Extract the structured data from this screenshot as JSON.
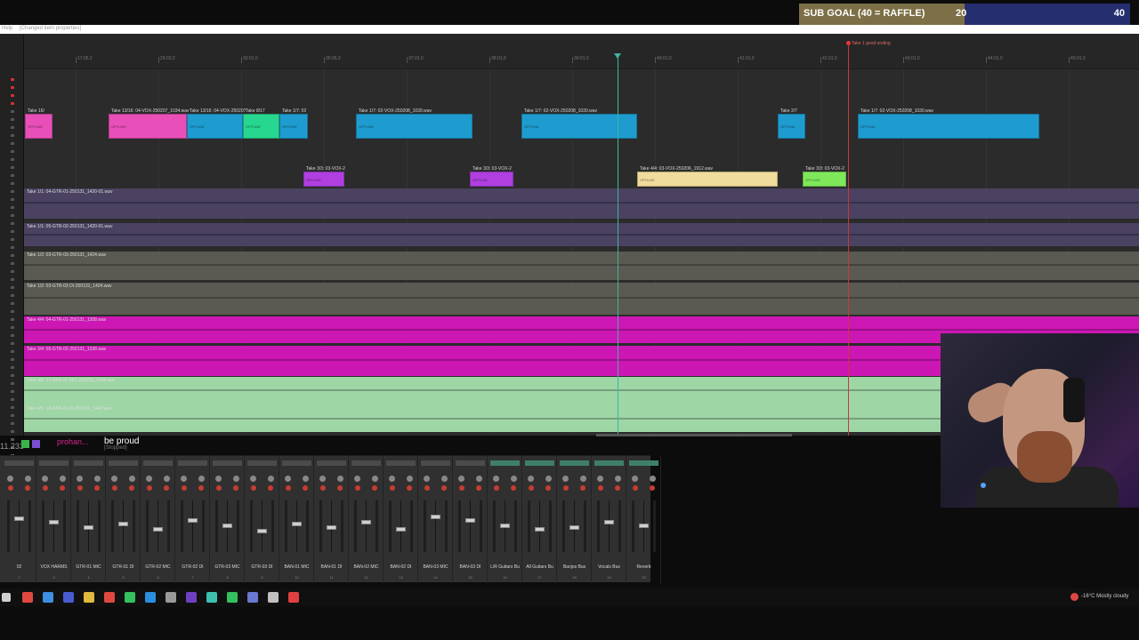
{
  "sub_goal": {
    "label": "SUB GOAL (40 = RAFFLE)",
    "current": "20",
    "target": "40",
    "progress": 0.5
  },
  "menu": {
    "help": "Help",
    "status": "[Changed item properties]"
  },
  "timeline": {
    "end_marker": "Take 1 good ending",
    "time_labels": [
      "17:05.2",
      "29:03.2",
      "33:01.0",
      "35:05.2",
      "37:01.0",
      "38:01.0",
      "39:01.0",
      "40:01.0",
      "41:01.0",
      "42:01.0",
      "43:01.0",
      "44:01.0",
      "45:01.0"
    ]
  },
  "clips": [
    {
      "lane": "top",
      "name": "Take 16/",
      "color": "#e84fb8",
      "inner": "OFFLINE"
    },
    {
      "lane": "top",
      "name": "Take 13/16: 04-VOX-250207_1034.wav",
      "color": "#e84fb8",
      "inner": "OFFLINE"
    },
    {
      "lane": "top",
      "name": "Take 13/16: 04-VOX-250207",
      "color": "#1e9ccf",
      "inner": "OFFLINE"
    },
    {
      "lane": "top",
      "name": "Take 8/17",
      "color": "#27d68f",
      "inner": "OFFLINE"
    },
    {
      "lane": "top",
      "name": "Take 1/7: 02",
      "color": "#1e9ccf",
      "inner": "OFFLINE"
    },
    {
      "lane": "top",
      "name": "Take 1/7: 02-VOX-250208_1030.wav",
      "color": "#1e9ccf",
      "inner": "OFFLINE"
    },
    {
      "lane": "top",
      "name": "Take 1/7: 02-VOX-250208_1030.wav",
      "color": "#1e9ccf",
      "inner": "OFFLINE"
    },
    {
      "lane": "top",
      "name": "Take 2/7",
      "color": "#1e9ccf",
      "inner": "OFFLINE"
    },
    {
      "lane": "top",
      "name": "Take 1/7: 02-VOX-250208_1030.wav",
      "color": "#1e9ccf",
      "inner": "OFFLINE"
    },
    {
      "lane": "mid",
      "name": "Take 3/3: 03-VOX-2",
      "color": "#b13fe0",
      "inner": "OFFLINE"
    },
    {
      "lane": "mid",
      "name": "Take 3/3: 03-VOX-2",
      "color": "#b13fe0",
      "inner": "OFFLINE"
    },
    {
      "lane": "mid",
      "name": "Take 4/4: 03-VOX-250206_1912.wav",
      "color": "#f0dc9c",
      "inner": "OFFLINE"
    },
    {
      "lane": "mid",
      "name": "Take 3/3: 03-VOX-2",
      "color": "#7ee85a",
      "inner": "OFFLINE"
    }
  ],
  "tracks": [
    {
      "name": "Take 1/1: 04-GTR-01-250131_1420-01.wav",
      "color": "#4a4260"
    },
    {
      "name": "Take 1/1: 05-GTR-02-250131_1420-01.wav",
      "color": "#4a4260"
    },
    {
      "name": "Take 1/2: 03-GTR-03-250131_1424.wav",
      "color": "#5a5a52"
    },
    {
      "name": "Take 1/2: 03-GTR-03 DI-250131_1424.wav",
      "color": "#5a5a52"
    },
    {
      "name": "Take 4/4: 04-GTR-01-250131_1308.wav",
      "color": "#cc17b4"
    },
    {
      "name": "Take 3/4: 05-GTR-02-250131_1338.wav",
      "color": "#cc17b4"
    },
    {
      "name": "Take 4/5: 13-BAN-01 MIC-250203_1448.wav",
      "color": "#9ed6a6"
    },
    {
      "name": "Take 4/5: 14-BAN-01 DI-250203_1448.wav",
      "color": "#9ed6a6"
    }
  ],
  "chat": {
    "user": "prohan...",
    "message": "be proud",
    "sub": "[Stopped]",
    "counter": "11.233"
  },
  "mixer": {
    "strips": [
      {
        "name": "02",
        "num": "2"
      },
      {
        "name": "VOX HARMS",
        "num": "3"
      },
      {
        "name": "GTR-01 MIC",
        "num": "4"
      },
      {
        "name": "GTR-01 DI",
        "num": "5"
      },
      {
        "name": "GTR-02 MIC",
        "num": "6"
      },
      {
        "name": "GTR-02 DI",
        "num": "7"
      },
      {
        "name": "GTR-03 MIC",
        "num": "8"
      },
      {
        "name": "GTR-03 DI",
        "num": "9"
      },
      {
        "name": "BAN-01 MIC",
        "num": "10"
      },
      {
        "name": "BAN-01 DI",
        "num": "11"
      },
      {
        "name": "BAN-02 MIC",
        "num": "12"
      },
      {
        "name": "BAN-02 DI",
        "num": "13"
      },
      {
        "name": "BAN-03 MIC",
        "num": "14"
      },
      {
        "name": "BAN-03 DI",
        "num": "15"
      },
      {
        "name": "L/R Guitars Bu",
        "num": "16"
      },
      {
        "name": "All Guitars Bu",
        "num": "17"
      },
      {
        "name": "Banjos Bus",
        "num": "18"
      },
      {
        "name": "Vocals Bus",
        "num": "19"
      },
      {
        "name": "Reverb",
        "num": "20"
      }
    ]
  },
  "taskbar": {
    "icons": [
      "start-icon",
      "chrome-icon",
      "file-explorer-icon",
      "app-icon",
      "folder-icon",
      "chrome-icon",
      "spotify-icon",
      "edge-icon",
      "settings-icon",
      "obs-icon",
      "steam-icon",
      "spotify-icon",
      "app-icon",
      "reaper-icon",
      "record-icon"
    ],
    "weather": "-16°C  Mostly cloudy"
  },
  "colors": {
    "accent_playhead": "#3fb3a0",
    "end_marker": "#c43a3a",
    "subgoal_fill": "#7d6f46",
    "subgoal_bg": "#252e6e"
  }
}
